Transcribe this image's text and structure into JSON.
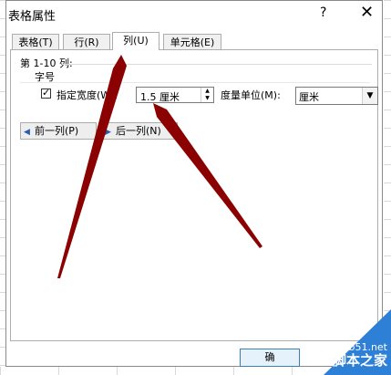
{
  "window": {
    "title": "表格属性",
    "help_glyph": "?",
    "close_glyph": "✕"
  },
  "tabs": [
    {
      "label": "表格(T)"
    },
    {
      "label": "行(R)"
    },
    {
      "label": "列(U)",
      "active": true
    },
    {
      "label": "单元格(E)"
    }
  ],
  "column_tab": {
    "range_text": "第 1-10 列:",
    "font_size_label": "字号",
    "specify_width": {
      "label": "指定宽度(W):",
      "checked": true,
      "value": "1.5 厘米"
    },
    "unit": {
      "label": "度量单位(M):",
      "selected": "厘米"
    },
    "prev_column_button": "前一列(P)",
    "next_column_button": "后一列(N)"
  },
  "footer": {
    "ok_button": "确"
  },
  "watermark": {
    "url": "jb51.net",
    "name": "脚本之家"
  },
  "colors": {
    "annotation_arrow": "#8b0000",
    "watermark_bg": "#2e7fd6"
  },
  "icons": {
    "prev": "arrow-left-icon",
    "next": "arrow-right-icon",
    "checkbox": "checkmark-icon",
    "select": "chevron-down-icon"
  }
}
